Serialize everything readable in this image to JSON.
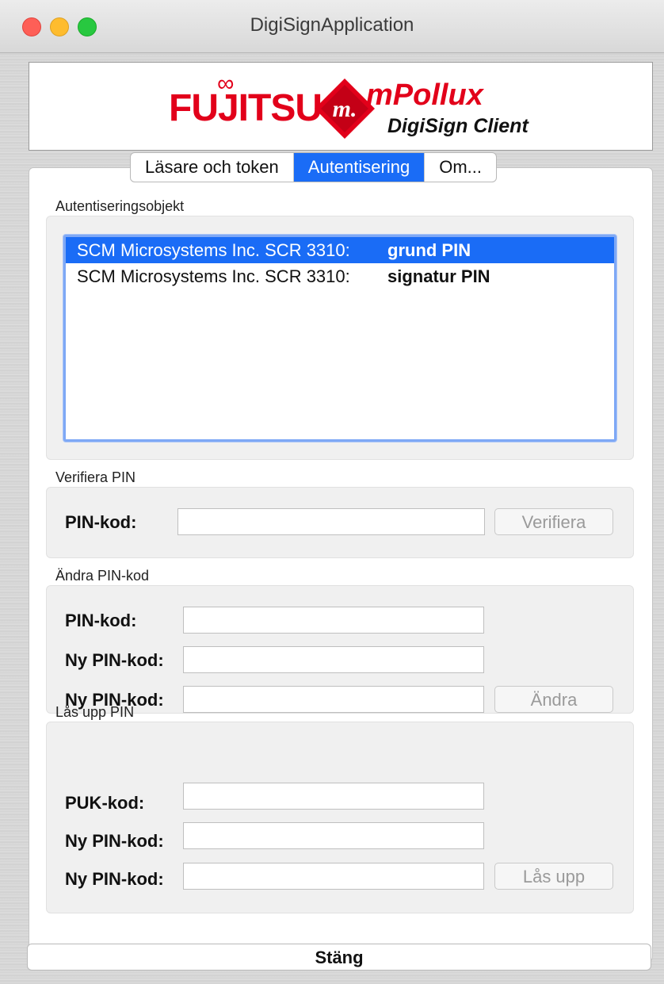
{
  "window": {
    "title": "DigiSignApplication"
  },
  "logo": {
    "fujitsu": "FUJITSU",
    "badge_letter": "m.",
    "product": "mPollux",
    "subtitle": "DigiSign Client",
    "brand_color": "#e2001a"
  },
  "tabs": [
    {
      "label": "Läsare och token",
      "active": false
    },
    {
      "label": "Autentisering",
      "active": true
    },
    {
      "label": "Om...",
      "active": false
    }
  ],
  "auth_objects": {
    "label": "Autentiseringsobjekt",
    "items": [
      {
        "device": "SCM Microsystems Inc. SCR 3310:",
        "pin": "grund PIN",
        "selected": true
      },
      {
        "device": "SCM Microsystems Inc. SCR 3310:",
        "pin": "signatur PIN",
        "selected": false
      }
    ]
  },
  "verify_pin": {
    "label": "Verifiera PIN",
    "pin_label": "PIN-kod:",
    "pin_value": "",
    "button": "Verifiera"
  },
  "change_pin": {
    "label": "Ändra PIN-kod",
    "pin_label": "PIN-kod:",
    "new_pin_label": "Ny PIN-kod:",
    "confirm_pin_label": "Ny PIN-kod:",
    "button": "Ändra"
  },
  "unlock_pin": {
    "label": "Lås upp PIN",
    "puk_label": "PUK-kod:",
    "new_pin_label": "Ny PIN-kod:",
    "confirm_pin_label": "Ny PIN-kod:",
    "button": "Lås upp"
  },
  "footer": {
    "close_button": "Stäng"
  },
  "colors": {
    "accent": "#1a6cf6"
  }
}
